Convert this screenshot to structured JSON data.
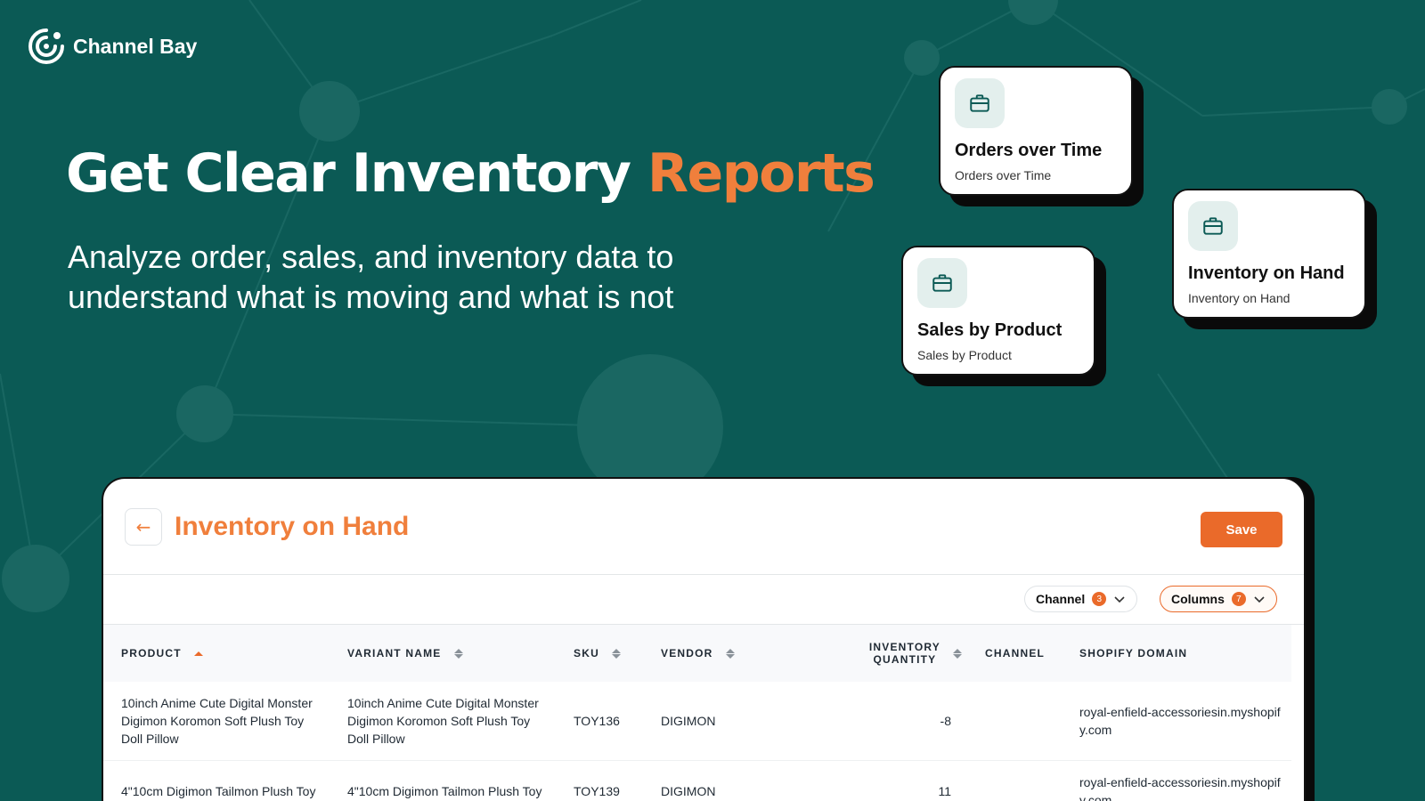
{
  "brand": {
    "name": "Channel Bay"
  },
  "hero": {
    "title_main": "Get Clear Inventory",
    "title_accent": "Reports",
    "subtitle_line1": "Analyze order, sales, and inventory data to",
    "subtitle_line2": "understand what is moving and what is not"
  },
  "report_cards": [
    {
      "title": "Orders over Time",
      "subtitle": "Orders over Time",
      "icon": "briefcase-icon"
    },
    {
      "title": "Inventory on Hand",
      "subtitle": "Inventory on Hand",
      "icon": "briefcase-icon"
    },
    {
      "title": "Sales by Product",
      "subtitle": "Sales by Product",
      "icon": "briefcase-icon"
    }
  ],
  "report": {
    "back_icon": "arrow-left-icon",
    "title": "Inventory on Hand",
    "save_label": "Save",
    "filters": {
      "channel": {
        "label": "Channel",
        "count": "3"
      },
      "columns": {
        "label": "Columns",
        "count": "7"
      }
    },
    "columns": [
      "PRODUCT",
      "VARIANT NAME",
      "SKU",
      "VENDOR",
      "INVENTORY QUANTITY",
      "CHANNEL",
      "SHOPIFY DOMAIN"
    ],
    "inventory_quantity_line1": "INVENTORY",
    "inventory_quantity_line2": "QUANTITY",
    "rows": [
      {
        "product": "10inch Anime Cute Digital Monster Digimon Koromon Soft Plush Toy Doll Pillow",
        "variant": "10inch Anime Cute Digital Monster Digimon Koromon Soft Plush Toy Doll Pillow",
        "sku": "TOY136",
        "vendor": "DIGIMON",
        "quantity": "-8",
        "channel": "",
        "domain": "royal-enfield-accessoriesin.myshopify.com"
      },
      {
        "product": "4\"10cm Digimon Tailmon Plush Toy",
        "variant": "4\"10cm Digimon Tailmon Plush Toy",
        "sku": "TOY139",
        "vendor": "DIGIMON",
        "quantity": "11",
        "channel": "",
        "domain": "royal-enfield-accessoriesin.myshopify.com"
      }
    ]
  },
  "colors": {
    "background": "#0b5a55",
    "accent": "#f07f3c",
    "button": "#ea6a2a"
  }
}
